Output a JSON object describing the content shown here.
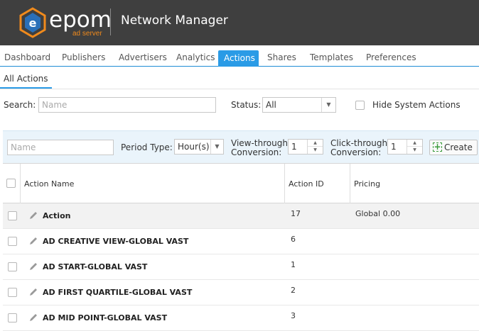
{
  "header": {
    "logo_word": "epom",
    "logo_sub": "ad server",
    "title": "Network Manager"
  },
  "nav": {
    "items": [
      {
        "label": "Dashboard"
      },
      {
        "label": "Publishers"
      },
      {
        "label": "Advertisers"
      },
      {
        "label": "Analytics"
      },
      {
        "label": "Actions",
        "active": true
      },
      {
        "label": "Shares"
      },
      {
        "label": "Templates"
      },
      {
        "label": "Preferences"
      }
    ]
  },
  "subtab": {
    "label": "All Actions"
  },
  "filters": {
    "search_label": "Search:",
    "search_placeholder": "Name",
    "status_label": "Status:",
    "status_value": "All",
    "hide_system_label": "Hide System Actions"
  },
  "toolbar": {
    "name_placeholder": "Name",
    "period_label": "Period Type:",
    "period_value": "Hour(s)",
    "view_label_1": "View-through",
    "view_label_2": "Conversion:",
    "view_value": "1",
    "click_label_1": "Click-through",
    "click_label_2": "Conversion:",
    "click_value": "1",
    "create_label": "Create"
  },
  "table": {
    "columns": [
      "Action Name",
      "Action ID",
      "Pricing"
    ],
    "rows": [
      {
        "name": "Action",
        "id": "17",
        "pricing": "Global 0.00"
      },
      {
        "name": "AD CREATIVE VIEW-GLOBAL VAST",
        "id": "6",
        "pricing": ""
      },
      {
        "name": "AD START-GLOBAL VAST",
        "id": "1",
        "pricing": ""
      },
      {
        "name": "AD FIRST QUARTILE-GLOBAL VAST",
        "id": "2",
        "pricing": ""
      },
      {
        "name": "AD MID POINT-GLOBAL VAST",
        "id": "3",
        "pricing": ""
      }
    ]
  },
  "colors": {
    "header_bg": "#3f3f3f",
    "accent": "#2a9be6",
    "logo_orange": "#f08a1c"
  }
}
